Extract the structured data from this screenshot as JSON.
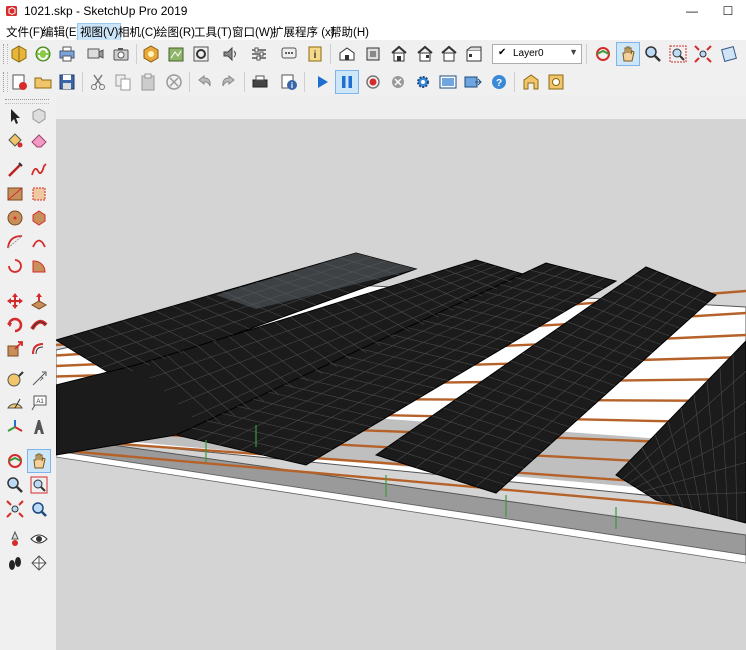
{
  "window": {
    "title": "1021.skp - SketchUp Pro 2019",
    "minimize_glyph": "—",
    "maximize_glyph": "☐",
    "close_glyph": "✕"
  },
  "menu": {
    "items": [
      {
        "label": "文件(F)"
      },
      {
        "label": "编辑(E)"
      },
      {
        "label": "视图(V)"
      },
      {
        "label": "相机(C)"
      },
      {
        "label": "绘图(R)"
      },
      {
        "label": "工具(T)"
      },
      {
        "label": "窗口(W)"
      },
      {
        "label": "扩展程序 (x)"
      },
      {
        "label": "帮助(H)"
      }
    ]
  },
  "toolbar": {
    "layer_check": "✔",
    "layer_name": "Layer0",
    "layer_arrow": "▼"
  },
  "model": {
    "panel_color": "#1b1b1b",
    "panel_line_color": "#4a4a4a",
    "rail_color": "#b5622a",
    "roof_top_color": "#ffffff",
    "roof_side_color": "#9a9a9a",
    "ground_color": "#d4d4d4",
    "sky_color": "#eeeeee",
    "accent_selection": "#cde6f8"
  }
}
